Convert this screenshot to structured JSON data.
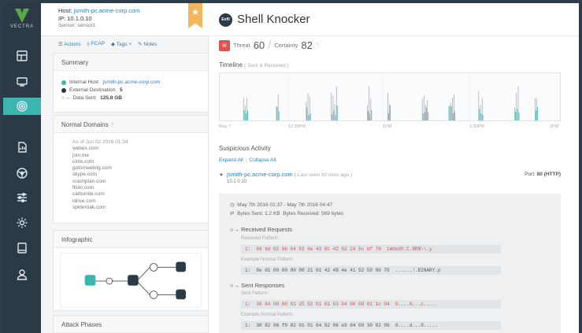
{
  "brand": {
    "name": "VECTRA",
    "color": "#5aa845"
  },
  "rail": {
    "items": [
      {
        "name": "dashboard-icon",
        "active": false
      },
      {
        "name": "hosts-icon",
        "active": false
      },
      {
        "name": "detections-icon",
        "active": true
      },
      {
        "name": "reports-icon",
        "active": false
      },
      {
        "name": "network-icon",
        "active": false
      },
      {
        "name": "filters-icon",
        "active": false
      },
      {
        "name": "settings-icon",
        "active": false
      },
      {
        "name": "inbox-icon",
        "active": false
      },
      {
        "name": "user-icon",
        "active": false
      }
    ]
  },
  "host": {
    "host_label": "Host:",
    "host_name": "jsmith-pc.acme-corp.com",
    "ip_label": "IP:",
    "ip": "10.1.0.10",
    "sensor_label": "Sensor:",
    "sensor": "sensor1"
  },
  "actions": {
    "actions": "Actions",
    "pcap": "PCAP",
    "tags": "Tags",
    "notes": "Notes"
  },
  "summary": {
    "title": "Summary",
    "internal_host_label": "Internal Host:",
    "internal_host": "jsmith-pc.acme-corp.com",
    "external_dest_label": "External Destination:",
    "external_dest": "5",
    "data_sent_label": "Data Sent:",
    "data_sent": "125.8 GB"
  },
  "normal_domains": {
    "title": "Normal Domains",
    "as_of": "As of Jun 02 2016 01:34",
    "list": [
      "webex.com",
      "join.me",
      "citrix.com",
      "gotomeeting.com",
      "skype.com",
      "crashplan.com",
      "flickr.com",
      "carbonite.com",
      "idrive.com",
      "spideroak.com"
    ]
  },
  "infographic": {
    "title": "Infographic"
  },
  "attack_phases": {
    "title": "Attack Phases"
  },
  "detection": {
    "badge": "Exfil",
    "title": "Shell Knocker",
    "threat_label": "Threat",
    "threat": "60",
    "certainty_label": "Certainty",
    "certainty": "82"
  },
  "timeline": {
    "title": "Timeline",
    "subtitle": "( Sent & Received )",
    "labels": [
      "May 7",
      "12:30PM",
      "1PM",
      "1:30PM",
      "2PM"
    ],
    "accent": "#3cb4b0"
  },
  "suspicious": {
    "title": "Suspicious Activity",
    "expand_all": "Expand All",
    "collapse_all": "Collapse All",
    "source_host": "jsmith-pc.acme-corp.com",
    "last_seen": "( Last seen 30 mins ago )",
    "source_ip": "10.1.0.10",
    "port_label": "Port:",
    "port": "80 (HTTP)"
  },
  "session": {
    "time_range": "May 7th 2016 01:37 - May 7th 2016 04:47",
    "bytes_sent": "Bytes Sent: 1.2 KB",
    "bytes_received": "Bytes Received: 569 bytes",
    "received_title": "Received Requests",
    "received_pattern_label": "Received Pattern:",
    "received_pattern": "1:  69 6d 62 6b 64 53 0e 43 8c 42 52 24 5c bf 79  imbkdS.C.BR$\\\\.y",
    "example_normal_label": "Example Normal Pattern:",
    "received_normal": "1:  8e 01 00 00 00 00 21 01 42 49 4e 41 52 59 00 70  ......!.BINARY.p",
    "sent_title": "Sent Responses",
    "sent_pattern_label": "Sent Pattern:",
    "sent_pattern": "1:  30 84 00 00 01 25 02 01 01 63 04 00 00 01 1c 04  0....%...c.....",
    "sent_normal_label": "Example Normal Pattern:",
    "sent_normal": "1:  30 82 06 f0 02 01 01 64 82 06 e9 04 00 30 82 06  0....d...0....."
  }
}
